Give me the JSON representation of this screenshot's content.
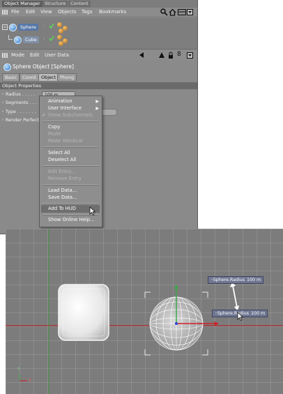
{
  "panel_tabs": [
    "Object Manager",
    "Structure",
    "Content"
  ],
  "menu": [
    "File",
    "Edit",
    "View",
    "Objects",
    "Tags",
    "Bookmarks"
  ],
  "objects": [
    {
      "name": "Sphere"
    },
    {
      "name": "Cube"
    }
  ],
  "attr_menu": [
    "Mode",
    "Edit",
    "User Data"
  ],
  "object_title": "Sphere Object [Sphere]",
  "prop_tabs": [
    "Basic",
    "Coord.",
    "Object",
    "Phong"
  ],
  "section_label": "Object Properties",
  "properties": [
    "Radius",
    "Segments",
    "Type",
    "Render Perfect"
  ],
  "radius_value": "100 m",
  "context_menu": {
    "items": [
      {
        "label": "Animation",
        "submenu": true
      },
      {
        "label": "User Interface",
        "submenu": true
      },
      {
        "label": "Show Subchannels",
        "checked": true,
        "disabled": true
      },
      {
        "label": "Copy"
      },
      {
        "label": "Paste",
        "disabled": true
      },
      {
        "label": "Paste Identical",
        "disabled": true
      },
      {
        "label": "Select All"
      },
      {
        "label": "Deselect All"
      },
      {
        "label": "Edit Entry...",
        "disabled": true
      },
      {
        "label": "Remove Entry",
        "disabled": true
      },
      {
        "label": "Load Data..."
      },
      {
        "label": "Save Data..."
      },
      {
        "label": "Add To HUD",
        "highlighted": true
      },
      {
        "label": "Show Online Help..."
      }
    ]
  },
  "hud": [
    {
      "label": "Sphere.Radius",
      "value": "100 m"
    },
    {
      "label": "Sphere.Radius",
      "value": "100 m"
    }
  ],
  "axis_labels": {
    "y": "Y",
    "x": "X"
  },
  "icons": [
    "search-icon",
    "home-icon",
    "layout-icon",
    "dropdown-icon",
    "back-arrow-icon",
    "up-arrow-icon",
    "lock-icon",
    "number-icon",
    "expand-icon",
    "tree-icon"
  ],
  "colors": {
    "panel_bg": "#8a8a8a",
    "viewport_bg": "#7c7c7c",
    "hud_bg": "#6f7690",
    "x_axis": "#c0141e",
    "y_axis": "#3f8f3f"
  }
}
